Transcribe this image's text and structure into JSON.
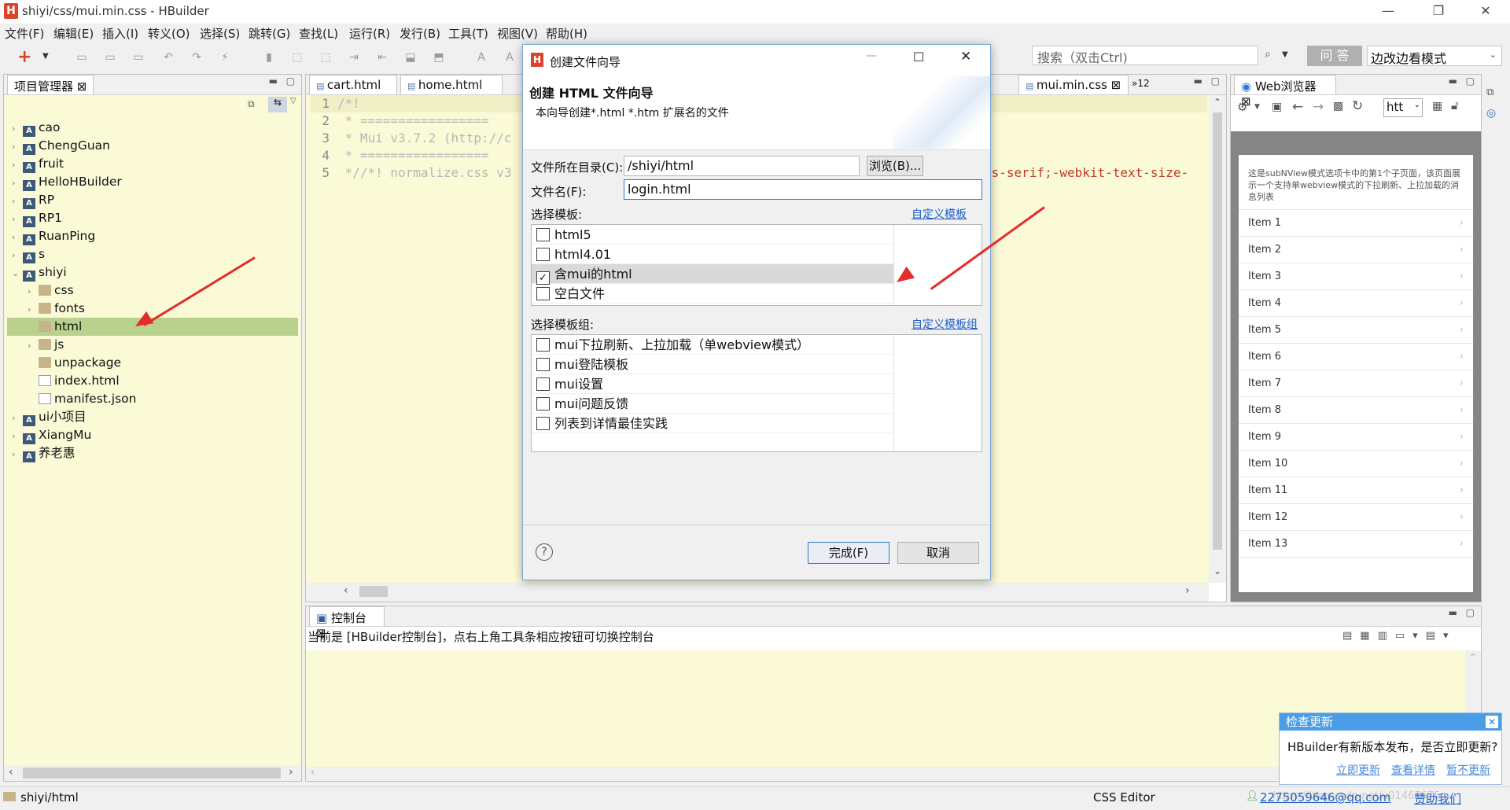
{
  "window": {
    "title": "shiyi/css/mui.min.css  -  HBuilder",
    "logo": "H"
  },
  "menu": [
    "文件(F)",
    "编辑(E)",
    "插入(I)",
    "转义(O)",
    "选择(S)",
    "跳转(G)",
    "查找(L)",
    "运行(R)",
    "发行(B)",
    "工具(T)",
    "视图(V)",
    "帮助(H)"
  ],
  "toolbar": {
    "search_placeholder": "搜索（双击Ctrl)",
    "ask_label": "问 答",
    "mode_label": "边改边看模式"
  },
  "project_panel": {
    "title": "项目管理器 ⊠",
    "items": [
      {
        "label": "cao",
        "type": "project",
        "arrow": "›"
      },
      {
        "label": "ChengGuan",
        "type": "project",
        "arrow": "›"
      },
      {
        "label": "fruit",
        "type": "project",
        "arrow": "›"
      },
      {
        "label": "HelloHBuilder",
        "type": "project",
        "arrow": "›"
      },
      {
        "label": "RP",
        "type": "project",
        "arrow": "›"
      },
      {
        "label": "RP1",
        "type": "project",
        "arrow": "›"
      },
      {
        "label": "RuanPing",
        "type": "project",
        "arrow": "›"
      },
      {
        "label": "s",
        "type": "project",
        "arrow": "›"
      },
      {
        "label": "shiyi",
        "type": "project",
        "arrow": "⌄"
      },
      {
        "label": "css",
        "type": "folder",
        "arrow": "›"
      },
      {
        "label": "fonts",
        "type": "folder",
        "arrow": "›"
      },
      {
        "label": "html",
        "type": "folder",
        "arrow": ""
      },
      {
        "label": "js",
        "type": "folder",
        "arrow": "›"
      },
      {
        "label": "unpackage",
        "type": "folder",
        "arrow": ""
      },
      {
        "label": "index.html",
        "type": "file",
        "arrow": ""
      },
      {
        "label": "manifest.json",
        "type": "file",
        "arrow": ""
      },
      {
        "label": "ui小项目",
        "type": "project",
        "arrow": "›"
      },
      {
        "label": "XiangMu",
        "type": "project",
        "arrow": "›"
      },
      {
        "label": "养老惠",
        "type": "project",
        "arrow": "›"
      }
    ]
  },
  "editor": {
    "tabs": [
      "cart.html",
      "home.html",
      "mui.min.css ⊠",
      "»12"
    ],
    "lines": [
      {
        "n": "1",
        "text": "/*!"
      },
      {
        "n": "2",
        "text": " * ================="
      },
      {
        "n": "3",
        "text": " * Mui v3.7.2 (http://c"
      },
      {
        "n": "4",
        "text": " * ================="
      },
      {
        "n": "5",
        "text": " *//*! normalize.css v3"
      }
    ],
    "right_code": "ns-serif;-webkit-text-size-"
  },
  "browser": {
    "tab": "Web浏览器 ⊠",
    "url": "htt",
    "intro": "这是subNView模式选项卡中的第1个子页面，该页面展示一个支持单webview模式的下拉刷新、上拉加载的消息列表",
    "items": [
      "Item 1",
      "Item 2",
      "Item 3",
      "Item 4",
      "Item 5",
      "Item 6",
      "Item 7",
      "Item 8",
      "Item 9",
      "Item 10",
      "Item 11",
      "Item 12",
      "Item 13"
    ]
  },
  "console": {
    "tab": "控制台 ⊠",
    "message": "当前是 [HBuilder控制台]，点右上角工具条相应按钮可切换控制台"
  },
  "dialog": {
    "title": "创建文件向导",
    "heading": "创建 HTML 文件向导",
    "description": "本向导创建*.html *.htm 扩展名的文件",
    "dir_label": "文件所在目录(C):",
    "dir_value": "/shiyi/html",
    "browse_label": "浏览(B)...",
    "name_label": "文件名(F):",
    "name_value": "login.html",
    "template_label": "选择模板:",
    "custom_template": "自定义模板",
    "templates": [
      {
        "label": "html5",
        "checked": false
      },
      {
        "label": "html4.01",
        "checked": false
      },
      {
        "label": "含mui的html",
        "checked": true
      },
      {
        "label": "空白文件",
        "checked": false
      }
    ],
    "group_label": "选择模板组:",
    "custom_group": "自定义模板组",
    "groups": [
      {
        "label": "mui下拉刷新、上拉加载（单webview模式）",
        "checked": false
      },
      {
        "label": "mui登陆模板",
        "checked": false
      },
      {
        "label": "mui设置",
        "checked": false
      },
      {
        "label": "mui问题反馈",
        "checked": false
      },
      {
        "label": "列表到详情最佳实践",
        "checked": false
      }
    ],
    "help": "?",
    "finish_label": "完成(F)",
    "cancel_label": "取消"
  },
  "update_popup": {
    "title": "检查更新",
    "message": "HBuilder有新版本发布，是否立即更新?",
    "links": [
      "立即更新",
      "查看详情",
      "暂不更新"
    ]
  },
  "status": {
    "path": "shiyi/html",
    "editor_mode": "CSS Editor",
    "email": "2275059646@qq.com",
    "sponsor": "赞助我们",
    "watermark": "https://blog.csdn.net/u01467675"
  },
  "colors": {
    "accent": "#4c9de8",
    "selection": "#b9d08e",
    "editor_bg": "#fbfad7",
    "arrow": "#e52b2b"
  }
}
